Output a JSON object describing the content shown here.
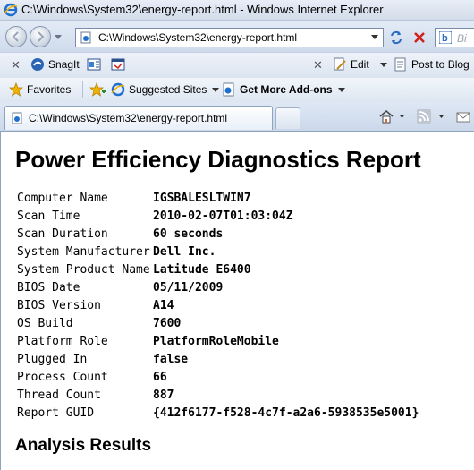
{
  "window": {
    "title": "C:\\Windows\\System32\\energy-report.html - Windows Internet Explorer"
  },
  "address_bar": {
    "url": "C:\\Windows\\System32\\energy-report.html"
  },
  "search": {
    "placeholder": "Bi"
  },
  "toolbar": {
    "snagit_label": "SnagIt",
    "edit_label": "Edit",
    "post_to_blog_label": "Post to Blog"
  },
  "favorites_bar": {
    "favorites_label": "Favorites",
    "suggested_sites_label": "Suggested Sites",
    "get_more_addons_label": "Get More Add-ons"
  },
  "tab": {
    "label": "C:\\Windows\\System32\\energy-report.html"
  },
  "report": {
    "title": "Power Efficiency Diagnostics Report",
    "rows": [
      {
        "key": "Computer Name",
        "value": "IGSBALESLTWIN7"
      },
      {
        "key": "Scan Time",
        "value": "2010-02-07T01:03:04Z"
      },
      {
        "key": "Scan Duration",
        "value": "60 seconds"
      },
      {
        "key": "System Manufacturer",
        "value": "Dell Inc."
      },
      {
        "key": "System Product Name",
        "value": "Latitude E6400"
      },
      {
        "key": "BIOS Date",
        "value": "05/11/2009"
      },
      {
        "key": "BIOS Version",
        "value": "A14"
      },
      {
        "key": "OS Build",
        "value": "7600"
      },
      {
        "key": "Platform Role",
        "value": "PlatformRoleMobile"
      },
      {
        "key": "Plugged In",
        "value": "false"
      },
      {
        "key": "Process Count",
        "value": "66"
      },
      {
        "key": "Thread Count",
        "value": "887"
      },
      {
        "key": "Report GUID",
        "value": "{412f6177-f528-4c7f-a2a6-5938535e5001}"
      }
    ],
    "section_heading": "Analysis Results"
  }
}
